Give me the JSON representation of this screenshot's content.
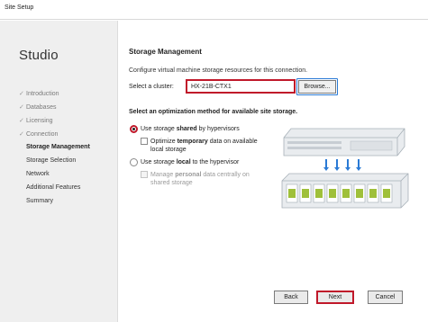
{
  "window": {
    "title": "Site Setup"
  },
  "nav": {
    "brand": "Studio",
    "steps": [
      {
        "label": "Introduction",
        "state": "done"
      },
      {
        "label": "Databases",
        "state": "done"
      },
      {
        "label": "Licensing",
        "state": "done"
      },
      {
        "label": "Connection",
        "state": "done"
      },
      {
        "label": "Storage Management",
        "state": "current"
      },
      {
        "label": "Storage Selection",
        "state": "pending"
      },
      {
        "label": "Network",
        "state": "pending"
      },
      {
        "label": "Additional Features",
        "state": "pending"
      },
      {
        "label": "Summary",
        "state": "pending"
      }
    ],
    "check_glyph": "✓"
  },
  "main": {
    "heading": "Storage Management",
    "description": "Configure virtual machine storage resources for this connection.",
    "cluster": {
      "label": "Select a cluster:",
      "value": "HX-21B-CTX1",
      "browse_label": "Browse..."
    },
    "optimization_heading": "Select an optimization method for available site storage.",
    "options": {
      "shared": {
        "label_pre": "Use storage ",
        "label_bold": "shared",
        "label_post": " by hypervisors",
        "selected": true,
        "sub": {
          "line1_pre": "Optimize ",
          "line1_bold": "temporary",
          "line1_post": " data on available",
          "line2": "local storage",
          "checked": false
        }
      },
      "local": {
        "label_pre": "Use storage ",
        "label_bold": "local",
        "label_post": " to the hypervisor",
        "selected": false,
        "sub": {
          "line1_pre": "Manage ",
          "line1_bold": "personal",
          "line1_post": " data centrally on",
          "line2": "shared storage",
          "checked": false,
          "disabled": true
        }
      }
    }
  },
  "footer": {
    "back_label": "Back",
    "next_label": "Next",
    "cancel_label": "Cancel"
  },
  "colors": {
    "highlight": "#c0182a",
    "nav_bg": "#efefef",
    "accent_blue": "#2a7ad5",
    "disk_green": "#9fc03a"
  },
  "icons": {
    "step_done": "check-icon",
    "illustration": "shared-storage-servers-illustration"
  }
}
